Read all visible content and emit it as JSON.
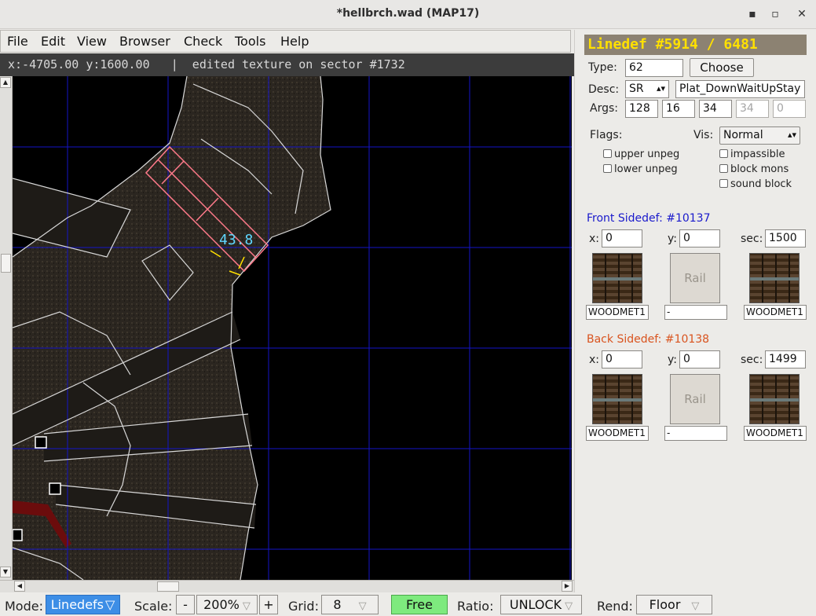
{
  "window": {
    "title": "*hellbrch.wad (MAP17)",
    "minimize": "▪",
    "maximize": "▫",
    "close": "✕"
  },
  "menu": [
    {
      "label": "File"
    },
    {
      "label": "Edit"
    },
    {
      "label": "View"
    },
    {
      "label": "Browser"
    },
    {
      "label": "Check"
    },
    {
      "label": "Tools"
    },
    {
      "label": "Help"
    }
  ],
  "status": {
    "text": "x:-4705.00 y:1600.00   |  edited texture on sector #1732"
  },
  "map": {
    "length_label": "43.8"
  },
  "panel": {
    "header": "Linedef #5914 / 6481",
    "type_label": "Type:",
    "type_value": "62",
    "choose_label": "Choose",
    "desc_label": "Desc:",
    "desc_trigger": "SR",
    "desc_text": "Plat_DownWaitUpStay",
    "args_label": "Args:",
    "args": [
      "128",
      "16",
      "34",
      "34",
      "0"
    ],
    "flags_label": "Flags:",
    "vis_label": "Vis:",
    "vis_value": "Normal",
    "flags": {
      "upper_unpeg": "upper unpeg",
      "lower_unpeg": "lower unpeg",
      "impassible": "impassible",
      "block_mons": "block mons",
      "sound_block": "sound block"
    },
    "front": {
      "title": "Front Sidedef: #10137",
      "color": "#1a1acc",
      "x_label": "x:",
      "x": "0",
      "y_label": "y:",
      "y": "0",
      "sec_label": "sec:",
      "sec": "1500",
      "upper": "WOODMET1",
      "rail": "Rail",
      "middle": "-",
      "lower": "WOODMET1"
    },
    "back": {
      "title": "Back Sidedef: #10138",
      "color": "#d9531e",
      "x_label": "x:",
      "x": "0",
      "y_label": "y:",
      "y": "0",
      "sec_label": "sec:",
      "sec": "1499",
      "upper": "WOODMET1",
      "rail": "Rail",
      "middle": "-",
      "lower": "WOODMET1"
    }
  },
  "bottom": {
    "mode_label": "Mode:",
    "mode_value": "Linedefs",
    "scale_label": "Scale:",
    "scale_minus": "-",
    "scale_value": "200%",
    "scale_plus": "+",
    "grid_label": "Grid:",
    "grid_value": "8",
    "free_label": "Free",
    "ratio_label": "Ratio:",
    "ratio_value": "UNLOCK",
    "rend_label": "Rend:",
    "rend_value": "Floor"
  }
}
